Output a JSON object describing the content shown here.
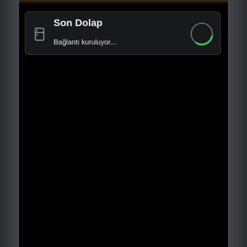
{
  "device": {
    "name": "Son Dolap",
    "status": "Bağlantı kuruluyor...",
    "icon": "fridge-icon",
    "state": "connecting"
  },
  "colors": {
    "background": "#000000",
    "card": "#18191b",
    "card_border": "#2e2f33",
    "text_primary": "#f2f2f2",
    "text_secondary": "#e2e2e2",
    "spinner_track": "#6e6f74",
    "spinner_accent": "#2fd35a"
  }
}
